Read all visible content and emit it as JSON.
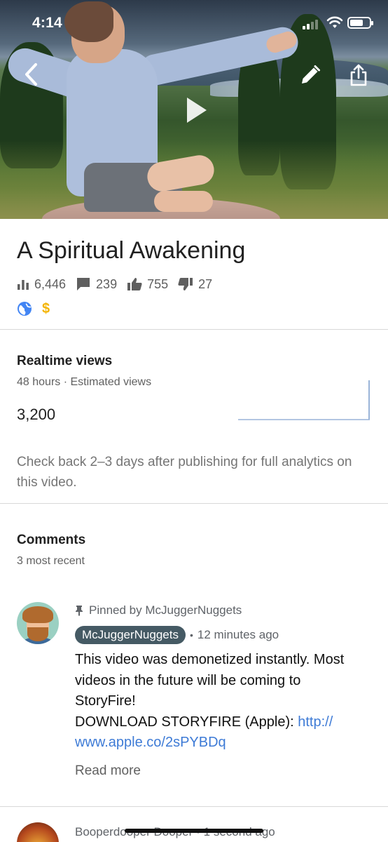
{
  "status_bar": {
    "time": "4:14"
  },
  "video": {
    "title": "A Spiritual Awakening",
    "stats": {
      "views": "6,446",
      "comments": "239",
      "likes": "755",
      "dislikes": "27"
    },
    "icons": [
      "bar-chart-icon",
      "comment-icon",
      "thumb-up-icon",
      "thumb-down-icon",
      "globe-icon",
      "dollar-icon"
    ],
    "visibility_color": "#4285f4",
    "monetization_symbol": "$",
    "monetization_color": "#f4b400"
  },
  "realtime": {
    "title": "Realtime views",
    "subtitle": "48 hours · Estimated views",
    "value": "3,200",
    "note": "Check back 2–3 days after publishing for full analytics on this video."
  },
  "comments": {
    "title": "Comments",
    "subtitle": "3 most recent",
    "items": [
      {
        "pinned_label": "Pinned by McJuggerNuggets",
        "author": "McJuggerNuggets",
        "time": "12 minutes ago",
        "lines": [
          "This video was demonetized instantly. Most",
          "videos in the future will be coming to",
          "StoryFire!"
        ],
        "line4_prefix": "DOWNLOAD STORYFIRE (Apple): ",
        "link_part1": "http://",
        "link_part2": "www.apple.co/2sPYBDq",
        "read_more": "Read more"
      },
      {
        "author": "Booperdooper Dooper",
        "time": "1 second ago"
      }
    ]
  },
  "colors": {
    "link": "#3e7bd6",
    "author_chip": "#455a64",
    "chart_line": "#9ab4d8"
  }
}
